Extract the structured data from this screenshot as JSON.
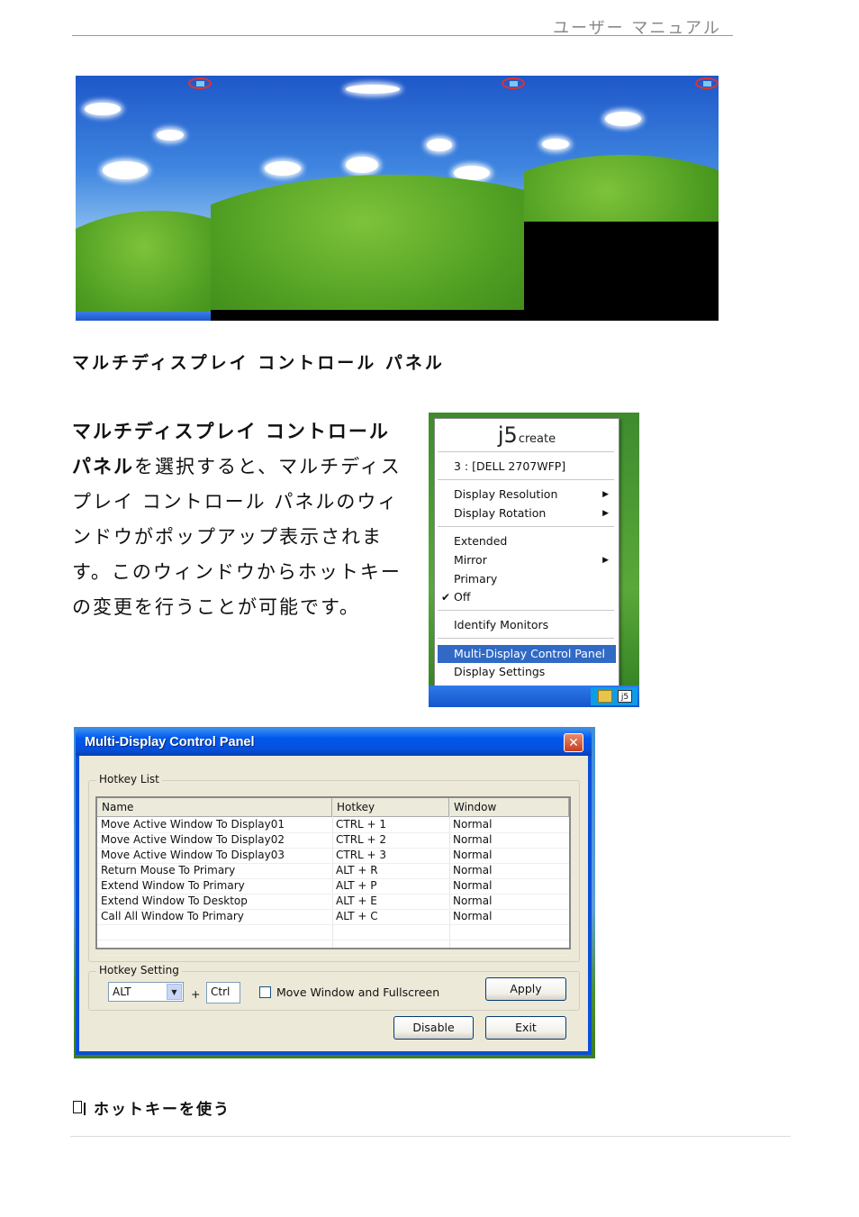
{
  "header": {
    "title": "ユーザー マニュアル"
  },
  "section_title": "マルチディスプレイ コントロール パネル",
  "body": {
    "bold": "マルチディスプレイ コントロール パネル",
    "text": "を選択すると、マルチディスプレイ コントロール パネルのウィンドウがポップアップ表示されます。このウィンドウからホットキーの変更を行うことが可能です。"
  },
  "menu": {
    "logo": "j5",
    "logo_suffix": "create",
    "display_name": "3 : [DELL 2707WFP]",
    "items": [
      {
        "label": "Display Resolution",
        "submenu": true
      },
      {
        "label": "Display Rotation",
        "submenu": true
      },
      {
        "label": "Extended"
      },
      {
        "label": "Mirror",
        "submenu": true
      },
      {
        "label": "Primary"
      },
      {
        "label": "Off",
        "checked": true
      },
      {
        "label": "Identify Monitors"
      },
      {
        "label": "Multi-Display Control Panel",
        "highlighted": true
      },
      {
        "label": "Display Settings"
      }
    ],
    "tray_icon": "j5"
  },
  "control_panel": {
    "title": "Multi-Display Control Panel",
    "close": "✕",
    "hotkey_list_label": "Hotkey List",
    "columns": [
      "Name",
      "Hotkey",
      "Window"
    ],
    "rows": [
      [
        "Move Active Window To Display01",
        "CTRL + 1",
        "Normal"
      ],
      [
        "Move Active Window To Display02",
        "CTRL + 2",
        "Normal"
      ],
      [
        "Move Active Window To Display03",
        "CTRL + 3",
        "Normal"
      ],
      [
        "Return Mouse To Primary",
        "ALT + R",
        "Normal"
      ],
      [
        "Extend Window To Primary",
        "ALT + P",
        "Normal"
      ],
      [
        "Extend Window To Desktop",
        "ALT + E",
        "Normal"
      ],
      [
        "Call All Window To Primary",
        "ALT + C",
        "Normal"
      ]
    ],
    "hotkey_setting_label": "Hotkey Setting",
    "modifier": "ALT",
    "plus": "+",
    "key": "Ctrl",
    "checkbox_label": "Move Window and Fullscreen",
    "apply": "Apply",
    "disable": "Disable",
    "exit": "Exit"
  },
  "footer_heading": "ホットキーを使う",
  "screens": [
    {
      "number": "1"
    },
    {
      "number": "3"
    },
    {
      "number": "2"
    }
  ]
}
